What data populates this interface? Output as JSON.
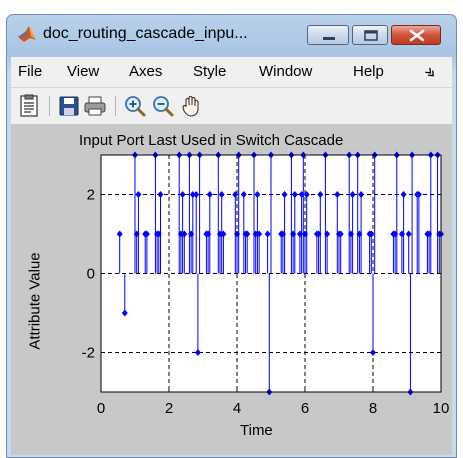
{
  "window": {
    "title": "doc_routing_cascade_inpu...",
    "controls": {
      "minimize_icon": "minimize-icon",
      "maximize_icon": "maximize-icon",
      "close_icon": "close-icon"
    }
  },
  "menubar": {
    "items": [
      {
        "label": "File"
      },
      {
        "label": "View"
      },
      {
        "label": "Axes"
      },
      {
        "label": "Style"
      },
      {
        "label": "Window"
      },
      {
        "label": "Help"
      }
    ],
    "overflow_icon": "chevron-more-icon"
  },
  "toolbar": {
    "buttons": [
      {
        "icon": "property-editor-icon"
      },
      {
        "icon": "save-icon"
      },
      {
        "icon": "print-icon"
      },
      {
        "icon": "zoom-in-icon"
      },
      {
        "icon": "zoom-out-icon"
      },
      {
        "icon": "pan-hand-icon"
      }
    ]
  },
  "colors": {
    "series": "#0000ff",
    "figure_background": "#c8c8c8",
    "axes_background": "#ffffff"
  },
  "chart_data": {
    "type": "stem",
    "title": "Input Port Last Used in Switch Cascade",
    "xlabel": "Time",
    "ylabel": "Attribute Value",
    "xlim": [
      0,
      10
    ],
    "ylim": [
      -3,
      3
    ],
    "xticks": [
      0,
      2,
      4,
      6,
      8,
      10
    ],
    "yticks": [
      -2,
      0,
      2
    ],
    "grid": true,
    "grid_style": "dashed",
    "series": [
      {
        "x": [
          0.55,
          0.7,
          1.0,
          1.05,
          1.1,
          1.3,
          1.35,
          1.6,
          1.65,
          1.7,
          1.75,
          2.3,
          2.35,
          2.4,
          2.45,
          2.6,
          2.65,
          2.7,
          2.8,
          2.85,
          2.9,
          3.1,
          3.15,
          3.2,
          3.45,
          3.5,
          3.55,
          3.6,
          3.95,
          4.0,
          4.05,
          4.2,
          4.25,
          4.3,
          4.5,
          4.55,
          4.6,
          4.65,
          4.9,
          4.95,
          5.0,
          5.3,
          5.35,
          5.4,
          5.6,
          5.65,
          5.7,
          5.85,
          5.9,
          5.95,
          6.0,
          6.05,
          6.35,
          6.4,
          6.45,
          6.6,
          6.65,
          6.95,
          7.0,
          7.05,
          7.3,
          7.35,
          7.4,
          7.55,
          7.6,
          7.65,
          7.9,
          7.95,
          8.0,
          8.05,
          8.6,
          8.65,
          8.7,
          8.85,
          8.9,
          9.05,
          9.1,
          9.15,
          9.3,
          9.35,
          9.6,
          9.65,
          9.7,
          9.9,
          9.95,
          10.0
        ],
        "y": [
          1,
          -1,
          3,
          1,
          2,
          1,
          1,
          3,
          1,
          1,
          2,
          3,
          1,
          2,
          1,
          3,
          1,
          2,
          2,
          -2,
          3,
          1,
          1,
          2,
          3,
          1,
          2,
          1,
          2,
          1,
          3,
          2,
          1,
          1,
          3,
          1,
          2,
          1,
          1,
          -3,
          3,
          1,
          1,
          2,
          3,
          1,
          2,
          1,
          2,
          3,
          1,
          2,
          1,
          1,
          2,
          3,
          1,
          2,
          1,
          1,
          3,
          1,
          2,
          3,
          1,
          2,
          1,
          1,
          -2,
          3,
          1,
          1,
          3,
          1,
          2,
          1,
          -3,
          3,
          2,
          2,
          1,
          1,
          3,
          3,
          1,
          1
        ]
      }
    ]
  }
}
